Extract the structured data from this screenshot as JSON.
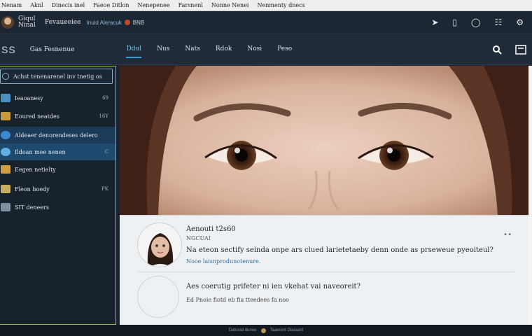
{
  "bookmarks": [
    "Nenam",
    "Aknl",
    "Dinecis inel",
    "Faeoe Ditlon",
    "Nenepenee",
    "Farsnenl",
    "Nonne Nenei",
    "Nenmenty dnecs"
  ],
  "appbar": {
    "name": "Giqul Ninal",
    "brand": "Fevaueeiee",
    "link": "Inuid Aleracuk",
    "code": "BNB"
  },
  "navbar": {
    "logo": "SS",
    "search_label": "Gas Fesnenue",
    "tabs": [
      {
        "label": "Ddul",
        "active": true
      },
      {
        "label": "Nus",
        "active": false
      },
      {
        "label": "Nats",
        "active": false
      },
      {
        "label": "Rdok",
        "active": false
      },
      {
        "label": "Nosi",
        "active": false
      },
      {
        "label": "Peso",
        "active": false
      }
    ]
  },
  "sidebar": {
    "search_placeholder": "Achst tenenarenel inv tnetig os",
    "items": [
      {
        "label": "Ieaoanesy",
        "count": "69",
        "color": "#4a8fc0"
      },
      {
        "label": "Eoured neatdes",
        "count": "16Y",
        "color": "#c99a3a"
      },
      {
        "label": "Aldeaer denorendeses delero",
        "count": "",
        "color": "#3a8ad0"
      },
      {
        "label": "Ildoan mee nenen",
        "count": "C",
        "color": "#5fb0e0"
      },
      {
        "label": "Eegen netielty",
        "count": "",
        "color": "#d0a040"
      },
      {
        "label": "Fleon hoedy",
        "count": "PK",
        "color": "#c8b060"
      },
      {
        "label": "SIT deneers",
        "count": "",
        "color": "#8090a0"
      }
    ]
  },
  "post": {
    "name": "Aenouti t2s60",
    "sub": "NGCUAI",
    "text": "Na eteon sectify seinda onpe ars clued larietetaeby denn onde as prseweue pyeoiteul?",
    "meta": "Nooe laisnprodunotenure.",
    "more": "• •"
  },
  "reply": {
    "question": "Aes coerutig prifeter ni ien vkehat vai naveoreit?",
    "meta": "Ed Pnoie fiotd eb fia tteedees fa noo"
  },
  "footer": {
    "left": "Datorad dunee",
    "right": "Taaerent Diaraant"
  }
}
